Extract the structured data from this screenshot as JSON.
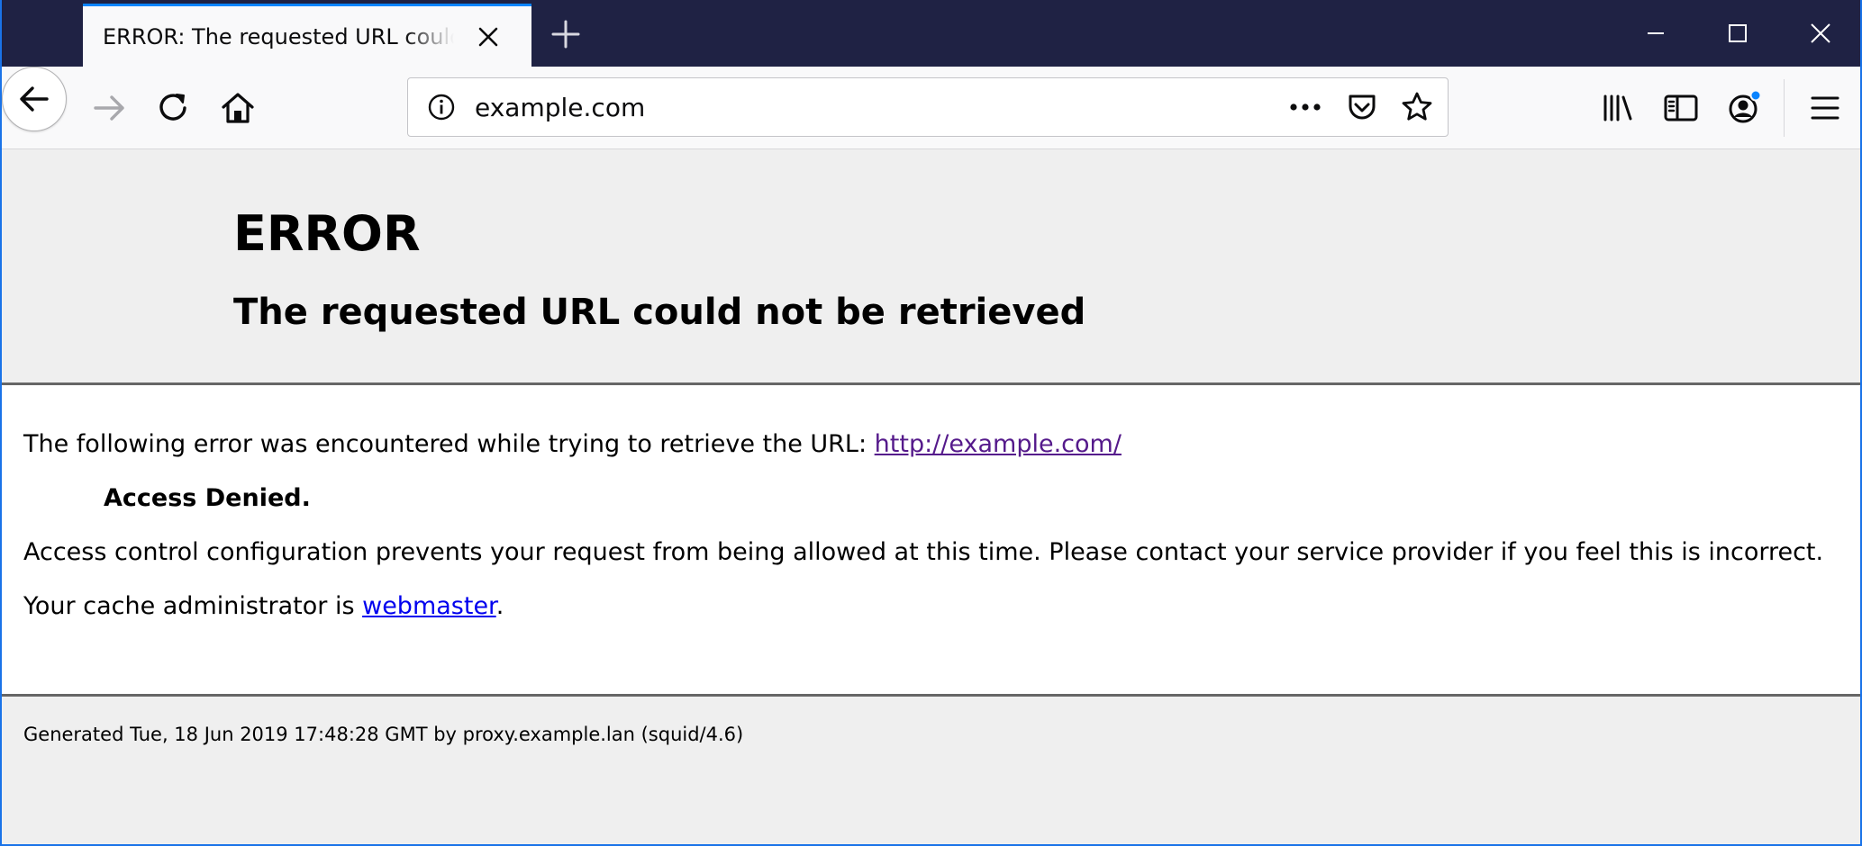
{
  "browser": {
    "tab": {
      "title": "ERROR: The requested URL could not be retrieved"
    },
    "urlbar": {
      "url": "example.com"
    },
    "colors": {
      "tabstrip": "#1f2244",
      "active_tab_accent": "#0a84ff",
      "account_badge": "#0a84ff"
    },
    "icons": {
      "tab_close": "close-icon",
      "new_tab": "plus-icon",
      "minimize": "minimize-icon",
      "maximize": "maximize-icon",
      "close": "close-icon",
      "back": "back-arrow-icon",
      "forward": "forward-arrow-icon",
      "reload": "reload-icon",
      "home": "home-icon",
      "site_info": "info-icon",
      "page_actions": "more-dots-icon",
      "pocket": "pocket-icon",
      "bookmark": "star-icon",
      "library": "library-icon",
      "sidebar": "sidebar-icon",
      "account": "account-icon",
      "menu": "hamburger-menu-icon"
    }
  },
  "page": {
    "header": {
      "title": "ERROR",
      "subtitle": "The requested URL could not be retrieved"
    },
    "body": {
      "encountered_prefix": "The following error was encountered while trying to retrieve the URL: ",
      "url_link": "http://example.com/",
      "error_name": "Access Denied.",
      "description": "Access control configuration prevents your request from being allowed at this time. Please contact your service provider if you feel this is incorrect.",
      "admin_prefix": "Your cache administrator is ",
      "admin_link": "webmaster",
      "admin_suffix": "."
    },
    "footer": {
      "generated": "Generated Tue, 18 Jun 2019 17:48:28 GMT by proxy.example.lan (squid/4.6)"
    },
    "colors": {
      "visited_link": "#551a8b",
      "link": "#0000ee",
      "divider": "#666666",
      "header_bg": "#efefef"
    }
  }
}
